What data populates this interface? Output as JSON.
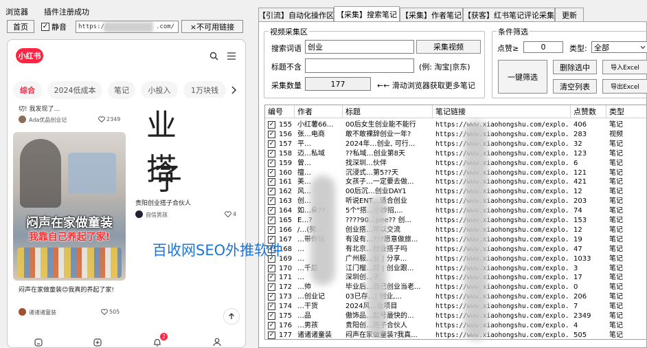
{
  "topbar": {
    "browser_label": "浏览器",
    "plugin_status": "插件注册成功",
    "home_button": "首页",
    "mute_label": "静音",
    "url_prefix": "https://",
    "url_suffix": ".com/",
    "unavailable_button": "×不可用链接"
  },
  "phone": {
    "logo": "小红书",
    "chips": [
      "综合",
      "2024低成本",
      "笔记",
      "小投入",
      "1万块钱"
    ],
    "card1": {
      "top_text": "切! 我发现了...",
      "author": "Ada优品创业记",
      "likes": "2349",
      "headline1": "闷声在家做童装",
      "headline2": "我靠自己养起了家!",
      "title": "闷声在家做童装😊我真的养起了家!",
      "author2": "诸诸诸童装",
      "likes2": "505"
    },
    "card2": {
      "handwriting1": "业 搭",
      "handwriting2": "子",
      "title": "贵阳创业搭子合伙人",
      "author": "自信男孩",
      "likes": "4"
    },
    "notif_count": "2"
  },
  "tabs": [
    "【引流】自动化操作区",
    "【采集】搜索笔记",
    "【采集】作者笔记",
    "【获客】红书笔记评论采集",
    "更新"
  ],
  "video_group": {
    "title": "视频采集区",
    "keyword_label": "搜索词语",
    "keyword_value": "创业",
    "collect_button": "采集视频",
    "exclude_label": "标题不含",
    "exclude_value": "",
    "exclude_hint": "(例: 淘宝|京东)",
    "count_label": "采集数量",
    "count_value": "177",
    "count_hint": "←← 滑动浏览器获取更多笔记"
  },
  "filter_group": {
    "title": "条件筛选",
    "likes_label": "点赞≥",
    "likes_value": "0",
    "type_label": "类型:",
    "type_value": "全部",
    "filter_button": "一键筛选",
    "delete_button": "删除选中",
    "clear_button": "清空列表",
    "import_button": "导入Excel",
    "export_button": "导出Excel"
  },
  "table": {
    "columns": [
      "编号",
      "作者",
      "标题",
      "笔记链接",
      "点赞数",
      "类型"
    ],
    "rows": [
      {
        "id": "155",
        "author": "小红薯66...",
        "title": "00后女生创业能不能行",
        "link": "https://www.xiaohongshu.com/explo...",
        "likes": "406",
        "type": "笔记"
      },
      {
        "id": "156",
        "author": "张…电商",
        "title": "敢不敢裸辞创业一年?",
        "link": "https://www.xiaohongshu.com/explo...",
        "likes": "283",
        "type": "视频"
      },
      {
        "id": "157",
        "author": "平…",
        "title": "2024年…创业, 可行...",
        "link": "https://www.xiaohongshu.com/explo...",
        "likes": "32",
        "type": "笔记"
      },
      {
        "id": "158",
        "author": "迈…私域",
        "title": "??私域…创业第8天",
        "link": "https://www.xiaohongshu.com/explo...",
        "likes": "123",
        "type": "笔记"
      },
      {
        "id": "159",
        "author": "曾…",
        "title": "找深圳…伙伴",
        "link": "https://www.xiaohongshu.com/explo...",
        "likes": "6",
        "type": "笔记"
      },
      {
        "id": "160",
        "author": "擅…",
        "title": "沉浸式…第5??天",
        "link": "https://www.xiaohongshu.com/explo...",
        "likes": "121",
        "type": "笔记"
      },
      {
        "id": "161",
        "author": "美…",
        "title": "女孩子…一定要去做...",
        "link": "https://www.xiaohongshu.com/explo...",
        "likes": "421",
        "type": "笔记"
      },
      {
        "id": "162",
        "author": "风…",
        "title": "00后沉…创业DAY1",
        "link": "https://www.xiaohongshu.com/explo...",
        "likes": "12",
        "type": "笔记"
      },
      {
        "id": "163",
        "author": "创…",
        "title": "听说ENT…适合创业",
        "link": "https://www.xiaohongshu.com/explo...",
        "likes": "203",
        "type": "笔记"
      },
      {
        "id": "164",
        "author": "如…朵??",
        "title": "5个\"搭…小妙招,...",
        "link": "https://www.xiaohongshu.com/explo...",
        "likes": "74",
        "type": "笔记"
      },
      {
        "id": "165",
        "author": "E…?",
        "title": "????90…pee?? 创...",
        "link": "https://www.xiaohongshu.com/explo...",
        "likes": "153",
        "type": "笔记"
      },
      {
        "id": "166",
        "author": "/…(努...",
        "title": "创业搭…可以交流",
        "link": "https://www.xiaohongshu.com/explo...",
        "likes": "12",
        "type": "笔记"
      },
      {
        "id": "167",
        "author": "…带你玩",
        "title": "有没有…???愿意做旅...",
        "link": "https://www.xiaohongshu.com/explo...",
        "likes": "19",
        "type": "笔记"
      },
      {
        "id": "168",
        "author": "…",
        "title": "有北京…创业搭子吗",
        "link": "https://www.xiaohongshu.com/explo...",
        "likes": "47",
        "type": "笔记"
      },
      {
        "id": "169",
        "author": "…",
        "title": "广州服…业 | 分享...",
        "link": "https://www.xiaohongshu.com/explo...",
        "likes": "1033",
        "type": "笔记"
      },
      {
        "id": "170",
        "author": "…千层",
        "title": "江门榴…层 | 创业跟...",
        "link": "https://www.xiaohongshu.com/explo...",
        "likes": "3",
        "type": "笔记"
      },
      {
        "id": "171",
        "author": "…",
        "title": "深圳创…子",
        "link": "https://www.xiaohongshu.com/explo...",
        "likes": "17",
        "type": "笔记"
      },
      {
        "id": "172",
        "author": "…帅",
        "title": "毕业后…自己创业当老...",
        "link": "https://www.xiaohongshu.com/explo...",
        "likes": "0",
        "type": "笔记"
      },
      {
        "id": "173",
        "author": "…创业记",
        "title": "03已存…| 创业,...",
        "link": "https://www.xiaohongshu.com/explo...",
        "likes": "206",
        "type": "笔记"
      },
      {
        "id": "174",
        "author": "…干货",
        "title": "2024风…业项目",
        "link": "https://www.xiaohongshu.com/explo...",
        "likes": "7",
        "type": "笔记"
      },
      {
        "id": "175",
        "author": "…品",
        "title": "傲饰品…起号最快的...",
        "link": "https://www.xiaohongshu.com/explo...",
        "likes": "2349",
        "type": "笔记"
      },
      {
        "id": "176",
        "author": "…男孩",
        "title": "贵阳创…搭子合伙人",
        "link": "https://www.xiaohongshu.com/explo...",
        "likes": "4",
        "type": "笔记"
      },
      {
        "id": "177",
        "author": "诸诸诸童装",
        "title": "闷声在家做童装?我真...",
        "link": "https://www.xiaohongshu.com/explo...",
        "likes": "505",
        "type": "笔记"
      }
    ]
  },
  "watermark": "百收网SEO外推软件",
  "colors": {
    "brand": "#ff2442",
    "watermark": "#1e74d6"
  }
}
